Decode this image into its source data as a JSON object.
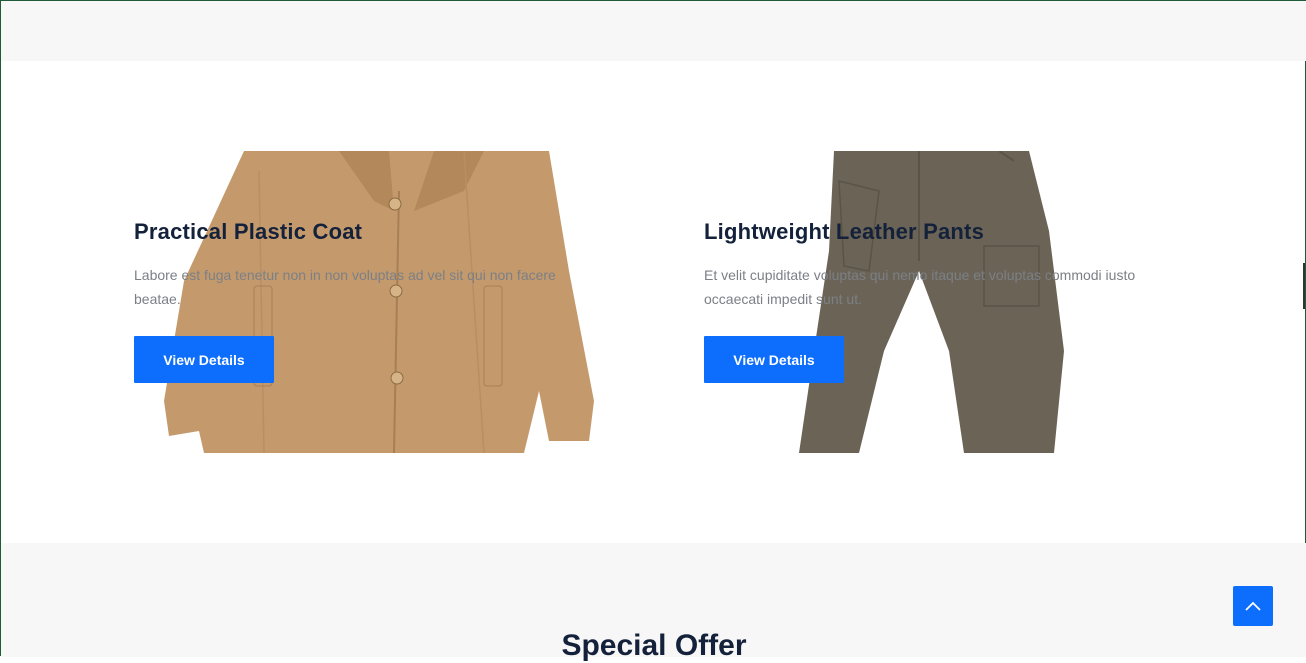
{
  "products": [
    {
      "title": "Practical Plastic Coat",
      "description": "Labore est fuga tenetur non in non voluptas ad vel sit qui non facere beatae.",
      "button_label": "View Details",
      "image": "coat-image"
    },
    {
      "title": "Lightweight Leather Pants",
      "description": "Et velit cupiditate voluptas qui nemo itaque et voluptas commodi iusto occaecati impedit sunt ut.",
      "button_label": "View Details",
      "image": "pants-image"
    }
  ],
  "next_section": {
    "title": "Special Offer"
  },
  "scroll_top": {
    "icon": "chevron-up-icon"
  },
  "colors": {
    "accent": "#0d6efd",
    "heading": "#14213a",
    "muted_text": "#7b7f86",
    "band": "#f7f7f7",
    "coat": "#c49a6c",
    "pants": "#6b6456"
  }
}
